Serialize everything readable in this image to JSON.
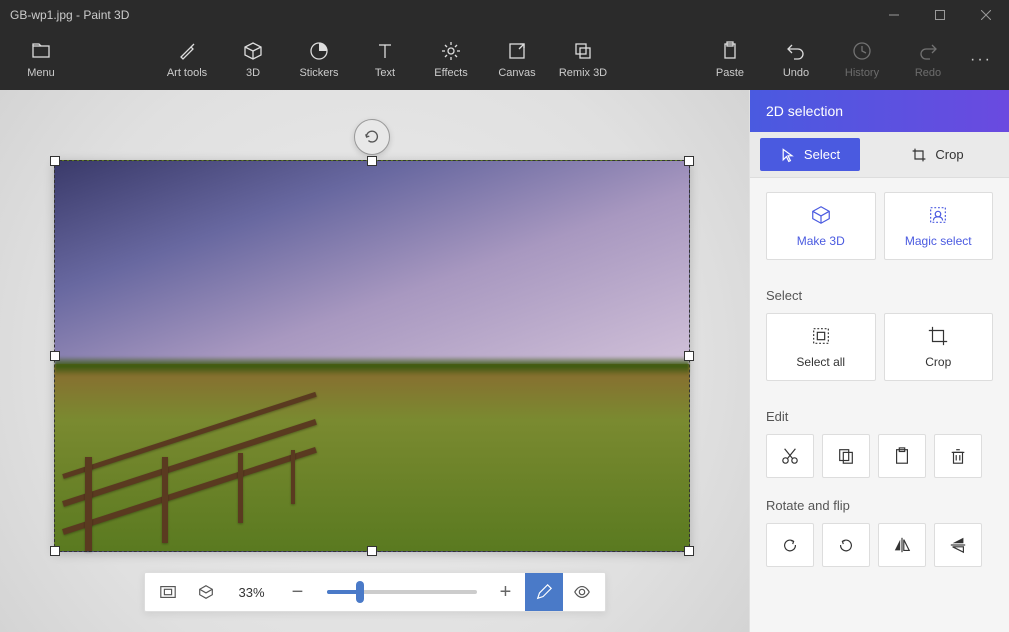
{
  "window": {
    "title": "GB-wp1.jpg - Paint 3D"
  },
  "ribbon": {
    "menu": "Menu",
    "art_tools": "Art tools",
    "three_d": "3D",
    "stickers": "Stickers",
    "text": "Text",
    "effects": "Effects",
    "canvas": "Canvas",
    "remix_3d": "Remix 3D",
    "paste": "Paste",
    "undo": "Undo",
    "history": "History",
    "redo": "Redo"
  },
  "zoom": {
    "level": "33%",
    "slider_percent": 22
  },
  "sidepanel": {
    "header": "2D selection",
    "tabs": {
      "select": "Select",
      "crop": "Crop",
      "active": "select"
    },
    "actions": {
      "make_3d": "Make 3D",
      "magic_select": "Magic select"
    },
    "select_section": {
      "label": "Select",
      "select_all": "Select all",
      "crop": "Crop"
    },
    "edit_section": {
      "label": "Edit"
    },
    "rotate_section": {
      "label": "Rotate and flip"
    }
  }
}
